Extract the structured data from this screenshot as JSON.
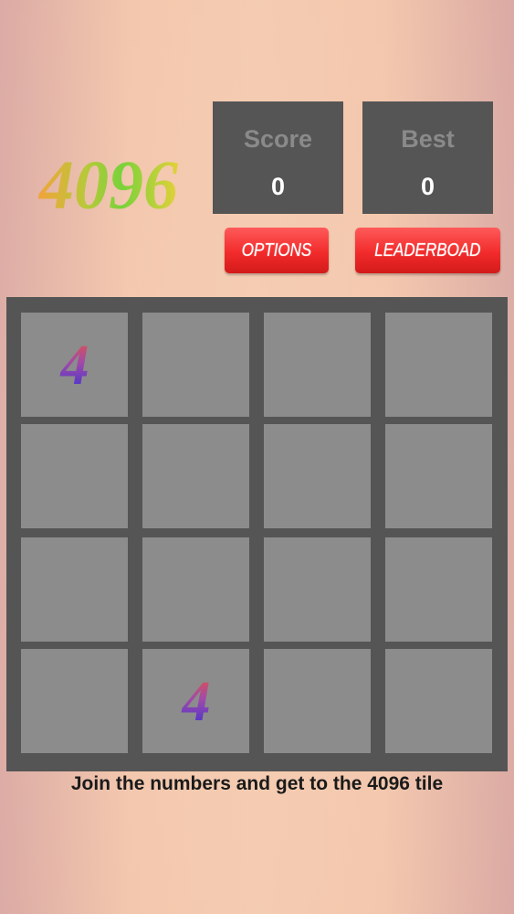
{
  "logo": {
    "text": "4096"
  },
  "stats": {
    "score_label": "Score",
    "score_value": "0",
    "best_label": "Best",
    "best_value": "0"
  },
  "buttons": {
    "options_label": "OPTIONS",
    "leaderboard_label": "LEADERBOAD"
  },
  "board": {
    "rows": [
      [
        "4",
        "",
        "",
        ""
      ],
      [
        "",
        "",
        "",
        ""
      ],
      [
        "",
        "",
        "",
        ""
      ],
      [
        "",
        "4",
        "",
        ""
      ]
    ]
  },
  "hint": "Join the numbers and get to the 4096 tile",
  "colors": {
    "board_bg": "#555555",
    "tile_bg": "#8c8c8c",
    "button_red": "#f22b2b"
  }
}
